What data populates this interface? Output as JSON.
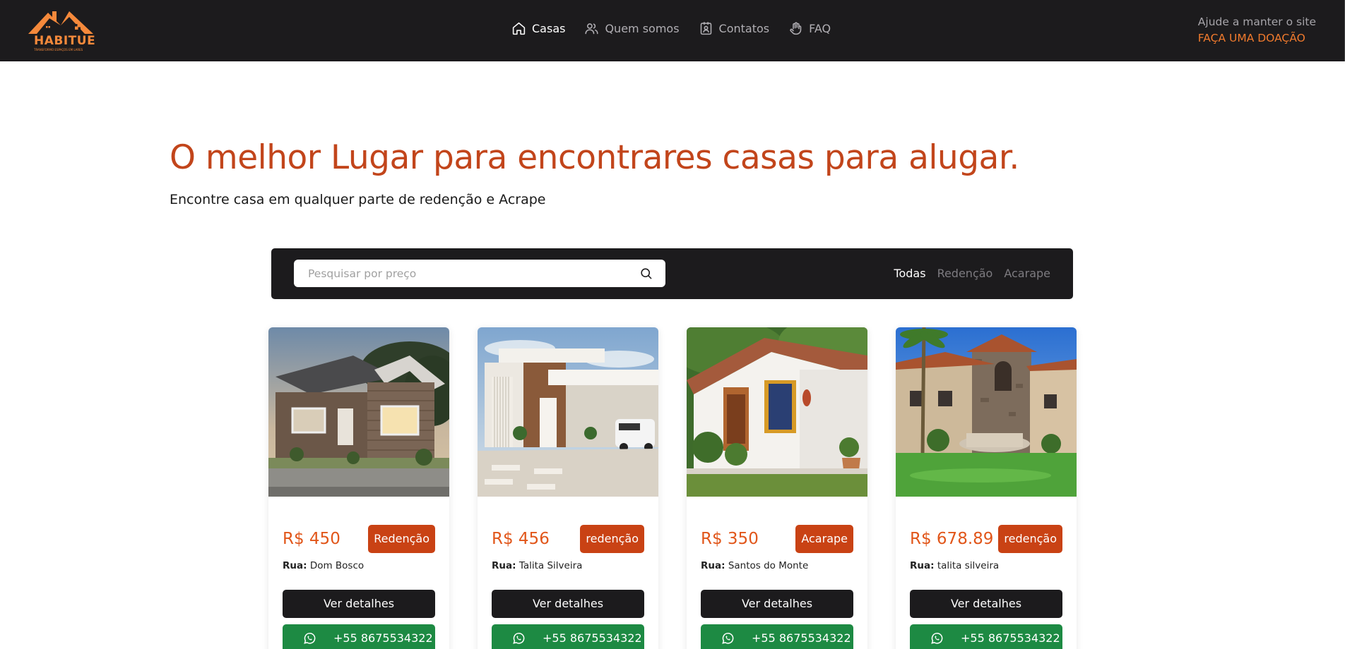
{
  "header": {
    "brand": "HABITUE",
    "tagline": "TRANSFORMO ESPAÇOS EM LARES",
    "nav": [
      {
        "label": "Casas",
        "icon": "home-icon",
        "active": true
      },
      {
        "label": "Quem somos",
        "icon": "users-icon",
        "active": false
      },
      {
        "label": "Contatos",
        "icon": "contact-card-icon",
        "active": false
      },
      {
        "label": "FAQ",
        "icon": "hand-icon",
        "active": false
      }
    ],
    "donate_help": "Ajude a manter o site",
    "donate_link": "FAÇA UMA DOAÇÃO"
  },
  "hero": {
    "title": "O melhor Lugar para encontrares casas para alugar.",
    "subtitle": "Encontre casa em qualquer parte de redenção e Acrape"
  },
  "search": {
    "placeholder": "Pesquisar por preço",
    "value": "",
    "filters": [
      {
        "label": "Todas",
        "active": true
      },
      {
        "label": "Redenção",
        "active": false
      },
      {
        "label": "Acarape",
        "active": false
      }
    ]
  },
  "cards": [
    {
      "price": "R$ 450",
      "city": "Redenção",
      "street_label": "Rua:",
      "street": "Dom Bosco",
      "details_label": "Ver detalhes",
      "phone": "+55 8675534322"
    },
    {
      "price": "R$ 456",
      "city": "redenção",
      "street_label": "Rua:",
      "street": "Talita Silveira",
      "details_label": "Ver detalhes",
      "phone": "+55 8675534322"
    },
    {
      "price": "R$ 350",
      "city": "Acarape",
      "street_label": "Rua:",
      "street": "Santos do Monte",
      "details_label": "Ver detalhes",
      "phone": "+55 8675534322"
    },
    {
      "price": "R$ 678.89",
      "city": "redenção",
      "street_label": "Rua:",
      "street": "talita silveira",
      "details_label": "Ver detalhes",
      "phone": "+55 8675534322"
    }
  ],
  "colors": {
    "header_bg": "#1c1b1d",
    "accent_orange": "#e1561a",
    "title_color": "#c2451b",
    "badge_bg": "#c94214",
    "whatsapp_green": "#1d8a43"
  }
}
